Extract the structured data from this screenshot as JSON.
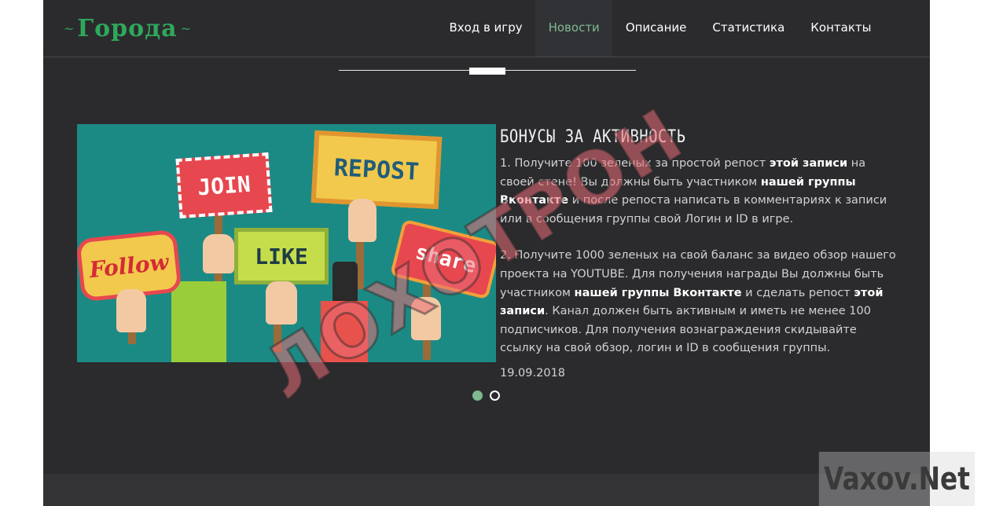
{
  "logo": {
    "text": "Города"
  },
  "nav": {
    "items": [
      {
        "label": "Вход в игру",
        "active": false
      },
      {
        "label": "Новости",
        "active": true
      },
      {
        "label": "Описание",
        "active": false
      },
      {
        "label": "Статистика",
        "active": false
      },
      {
        "label": "Контакты",
        "active": false
      }
    ]
  },
  "slide": {
    "image_signs": [
      "JOIN",
      "REPOST",
      "Follow",
      "LIKE",
      "share"
    ],
    "title": "БОНУСЫ ЗА АКТИВНОСТЬ",
    "p1": {
      "a": "1. Получите 100 зеленых за простой репост ",
      "link1": "этой записи",
      "b": " на своей стене! Вы должны быть участником ",
      "link2": "нашей группы Вконтакте",
      "c": " и после репоста написать в комментариях к записи или в сообщения группы свой Логин и ID в игре."
    },
    "p2": {
      "a": "2. Получите 1000 зеленых на свой баланс за видео обзор нашего проекта на YOUTUBE. Для получения награды Вы должны быть участником ",
      "link1": "нашей группы Вконтакте",
      "b": " и сделать репост ",
      "link2": "этой записи",
      "c": ". Канал должен быть активным и иметь не менее 100 подписчиков. Для получения вознаграждения скидывайте ссылку на свой обзор, логин и ID в сообщения группы."
    },
    "date": "19.09.2018"
  },
  "carousel": {
    "count": 2,
    "active_index": 0
  },
  "watermarks": {
    "main": "ЛОХОТРОН",
    "corner": "Vaxov.Net"
  },
  "colors": {
    "accent": "#2fa85b",
    "active_nav": "#7fb98f",
    "background": "#2b2b2e",
    "image_bg": "#1c8a84"
  }
}
